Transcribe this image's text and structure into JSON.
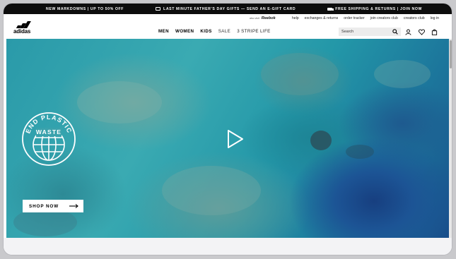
{
  "promo_bar": {
    "left_text": "NEW MARKDOWNS | UP TO 50% OFF",
    "center_text": "LAST MINUTE FATHER'S DAY GIFTS — SEND AN E-GIFT CARD",
    "right_text": "FREE SHIPPING & RETURNS | JOIN NOW"
  },
  "header": {
    "logo_text": "adidas",
    "partner_label": "also visit",
    "partner_brand": "Reebok",
    "utility_links": [
      "help",
      "exchanges & returns",
      "order tracker",
      "join creators club",
      "creators club",
      "log in"
    ],
    "nav": [
      "MEN",
      "WOMEN",
      "KIDS",
      "SALE",
      "3 STRIPE LIFE"
    ],
    "search_placeholder": "Search"
  },
  "icons": {
    "search": "search-icon",
    "account": "user-icon",
    "wishlist": "heart-icon",
    "bag": "shopping-bag-icon",
    "play": "play-icon",
    "arrow": "arrow-right-icon"
  },
  "hero": {
    "badge_line1": "END PLASTIC",
    "badge_line2": "WASTE",
    "cta_label": "SHOP NOW"
  },
  "colors": {
    "promo_bg": "#0d0d0d",
    "ocean_deep": "#184d8a",
    "ocean_shallow": "#3aaab2"
  }
}
